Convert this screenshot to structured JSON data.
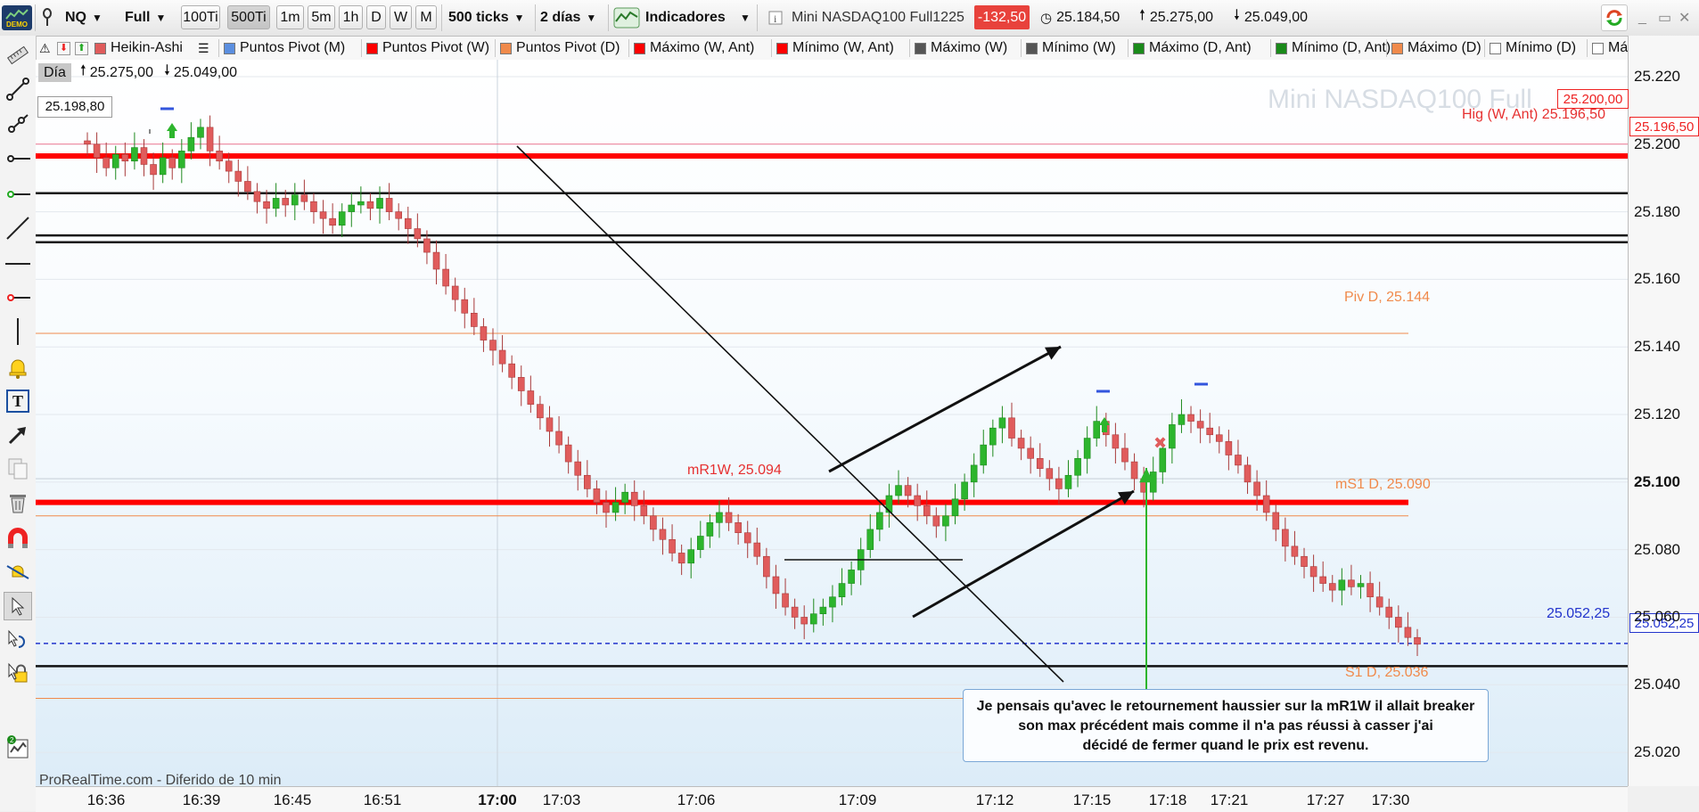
{
  "toolbar": {
    "demo_label": "DEMO",
    "symbol": "NQ",
    "view_mode": "Full",
    "period_buttons": [
      "100Ti",
      "500Ti",
      "1m",
      "5m",
      "1h",
      "D",
      "W",
      "M"
    ],
    "active_period": "500Ti",
    "units_select": "500 ticks",
    "range_select": "2 días",
    "indicators_label": "Indicadores",
    "instrument": "Mini NASDAQ100 Full1225",
    "change": "-132,50",
    "open": "25.184,50",
    "high": "25.275,00",
    "low": "25.049,00"
  },
  "legend": [
    {
      "label": "Heikin-Ashi",
      "color": "#e05c5c"
    },
    {
      "label": "Puntos Pivot (M)",
      "color": "#5b8fe0"
    },
    {
      "label": "Puntos Pivot (W)",
      "color": "#ff0000"
    },
    {
      "label": "Puntos Pivot (D)",
      "color": "#f08a4b"
    },
    {
      "label": "Máximo (W, Ant)",
      "color": "#ff0000"
    },
    {
      "label": "Mínimo (W, Ant)",
      "color": "#ff0000"
    },
    {
      "label": "Máximo (W)",
      "color": "#555555"
    },
    {
      "label": "Mínimo (W)",
      "color": "#555555"
    },
    {
      "label": "Máximo (D, Ant)",
      "color": "#1a8a1a"
    },
    {
      "label": "Mínimo (D, Ant)",
      "color": "#1a8a1a"
    },
    {
      "label": "Máximo (D)",
      "color": "#f08a4b"
    },
    {
      "label": "Mínimo (D)",
      "color": "#ffffff"
    },
    {
      "label": "Máxi",
      "color": "#ffffff"
    }
  ],
  "day_box": {
    "label": "Día",
    "high": "25.275,00",
    "low": "25.049,00"
  },
  "left_price_badge": "25.198,80",
  "watermark": "Mini NASDAQ100 Full",
  "y_axis": {
    "ticks": [
      "25.220",
      "25.200",
      "25.180",
      "25.160",
      "25.140",
      "25.120",
      "25.100",
      "25.080",
      "25.060",
      "25.040",
      "25.020"
    ],
    "badge_top": "25.200,00",
    "badge_high": "25.196,50",
    "badge_last": "25.052,25"
  },
  "x_axis": {
    "ticks": [
      "16:36",
      "16:39",
      "16:45",
      "16:51",
      "17:00",
      "17:03",
      "17:06",
      "17:09",
      "17:12",
      "17:15",
      "17:18",
      "17:21",
      "17:27",
      "17:30"
    ]
  },
  "chart_labels": {
    "high_w_ant": "Hig (W, Ant) 25.196,50",
    "piv_d": "Piv D, 25.144",
    "mr1w": "mR1W, 25.094",
    "ms1_d": "mS1 D, 25.090",
    "s1_d": "S1 D, 25.036",
    "last_price_line": "25.052,25"
  },
  "footer_note": "ProRealTime.com - Diferido de 10 min",
  "annotation": {
    "line1": "Je pensais qu'avec le retournement haussier sur la mR1W il allait breaker",
    "line2": "son max précédent mais comme il n'a pas réussi à casser j'ai",
    "line3": "décidé de fermer quand le prix est revenu."
  },
  "chart_data": {
    "type": "candlestick",
    "title": "Mini NASDAQ100 Full1225",
    "x_labels": [
      "16:36",
      "16:39",
      "16:45",
      "16:51",
      "17:00",
      "17:03",
      "17:06",
      "17:09",
      "17:12",
      "17:15",
      "17:18",
      "17:21",
      "17:27",
      "17:30"
    ],
    "ylim": [
      25010,
      25225
    ],
    "y_ticks": [
      25020,
      25040,
      25060,
      25080,
      25100,
      25120,
      25140,
      25160,
      25180,
      25200,
      25220
    ],
    "horizontal_levels": [
      {
        "name": "Hig (W, Ant)",
        "value": 25196.5,
        "color": "#ff0000"
      },
      {
        "name": "Piv D",
        "value": 25144,
        "color": "#f08a4b"
      },
      {
        "name": "mR1W",
        "value": 25094,
        "color": "#ff0000"
      },
      {
        "name": "mS1 D",
        "value": 25090,
        "color": "#f08a4b"
      },
      {
        "name": "S1 D",
        "value": 25036,
        "color": "#f08a4b"
      },
      {
        "name": "Last",
        "value": 25052.25,
        "color": "#2233cc"
      }
    ],
    "closes": [
      25200,
      25196,
      25193,
      25197,
      25195,
      25199,
      25194,
      25191,
      25196,
      25193,
      25198,
      25202,
      25205,
      25198,
      25195,
      25192,
      25189,
      25186,
      25183,
      25181,
      25184,
      25182,
      25185,
      25183,
      25180,
      25178,
      25176,
      25180,
      25182,
      25183,
      25181,
      25184,
      25180,
      25178,
      25175,
      25172,
      25168,
      25163,
      25158,
      25154,
      25150,
      25146,
      25142,
      25139,
      25135,
      25131,
      25127,
      25123,
      25119,
      25115,
      25111,
      25106,
      25102,
      25098,
      25094,
      25091,
      25094,
      25097,
      25093,
      25090,
      25086,
      25083,
      25079,
      25076,
      25080,
      25084,
      25088,
      25091,
      25088,
      25085,
      25082,
      25078,
      25072,
      25067,
      25063,
      25060,
      25058,
      25061,
      25063,
      25066,
      25070,
      25074,
      25080,
      25086,
      25091,
      25096,
      25099,
      25096,
      25093,
      25090,
      25087,
      25090,
      25095,
      25100,
      25105,
      25111,
      25116,
      25119,
      25113,
      25110,
      25107,
      25104,
      25101,
      25098,
      25102,
      25107,
      25113,
      25118,
      25114,
      25110,
      25106,
      25101,
      25097,
      25103,
      25110,
      25117,
      25120,
      25118,
      25116,
      25114,
      25112,
      25108,
      25105,
      25100,
      25096,
      25091,
      25086,
      25081,
      25078,
      25075,
      25072,
      25070,
      25068,
      25071,
      25069,
      25070,
      25066,
      25063,
      25060,
      25057,
      25054,
      25052
    ]
  }
}
